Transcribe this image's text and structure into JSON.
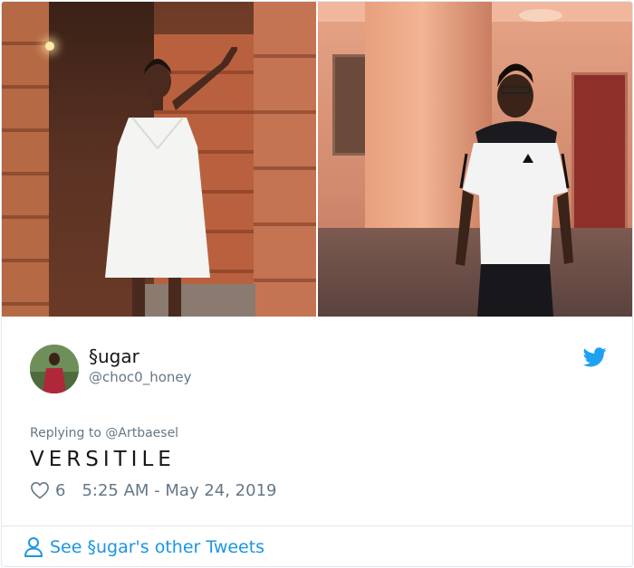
{
  "tweet": {
    "display_name": "§ugar",
    "handle": "@choc0_honey",
    "replying_to": "Replying to @Artbaesel",
    "text": "VERSITILE",
    "like_count": "6",
    "timestamp": "5:25 AM - May 24, 2019"
  },
  "footer": {
    "link_label": "See §ugar's other Tweets"
  },
  "icons": {
    "brand": "bird-icon",
    "like": "heart-icon",
    "profile": "person-icon"
  },
  "colors": {
    "brand_blue": "#1da1f2",
    "link_blue": "#1b95e0",
    "secondary_text": "#657786",
    "primary_text": "#14171a",
    "border": "#e1e8ed"
  }
}
